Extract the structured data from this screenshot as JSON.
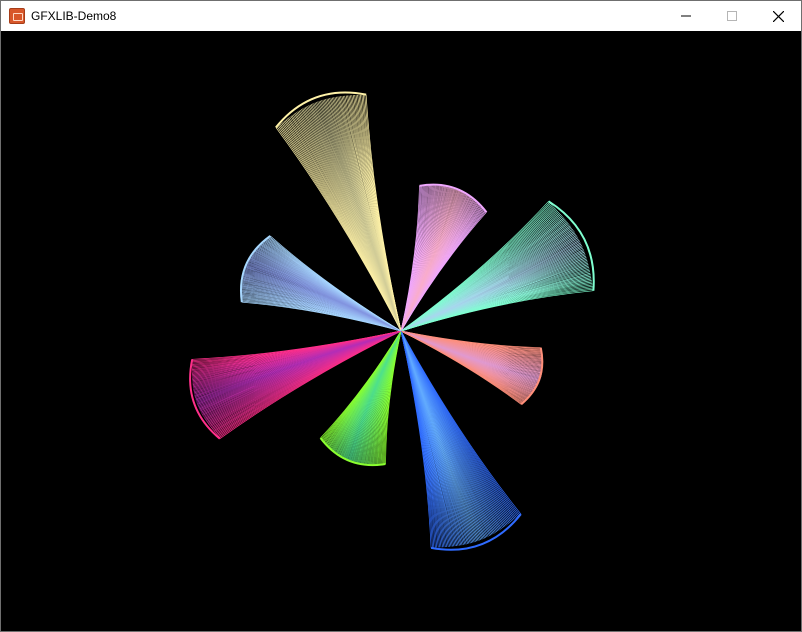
{
  "window": {
    "title": "GFXLIB-Demo8",
    "icon": "gfxlib-app-icon",
    "controls": [
      "minimize-icon",
      "maximize-icon",
      "close-icon"
    ]
  },
  "canvas": {
    "background": "#000000",
    "petals": [
      {
        "name": "petal-yellow",
        "color_tip": "#fff2a8",
        "color_base": "#b9b990"
      },
      {
        "name": "petal-pink",
        "color_tip": "#f0a8ff",
        "color_base": "#ffb0b0"
      },
      {
        "name": "petal-aqua",
        "color_tip": "#7fffd0",
        "color_base": "#c0c0ff"
      },
      {
        "name": "petal-salmon",
        "color_tip": "#ff8f7a",
        "color_base": "#d0a0ff"
      },
      {
        "name": "petal-blue",
        "color_tip": "#2f6bff",
        "color_base": "#80d0ff"
      },
      {
        "name": "petal-green",
        "color_tip": "#8aff2f",
        "color_base": "#2fd0c0"
      },
      {
        "name": "petal-magenta",
        "color_tip": "#ff2f8a",
        "color_base": "#8a2fd0"
      },
      {
        "name": "petal-lightblue",
        "color_tip": "#a8d8ff",
        "color_base": "#6f6fd0"
      }
    ]
  }
}
